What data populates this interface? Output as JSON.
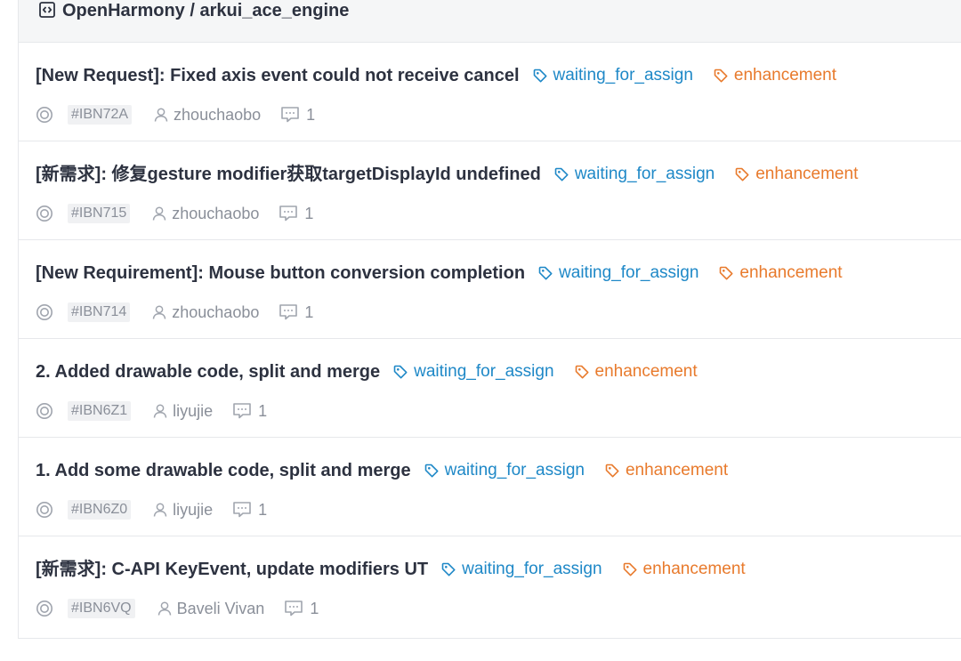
{
  "repo": {
    "title": "OpenHarmony / arkui_ace_engine",
    "icon": "repo-code-icon"
  },
  "colors": {
    "waiting_label": "#1e88c7",
    "enhancement_label": "#e87a2c",
    "meta_text": "#8a8f99"
  },
  "issues": [
    {
      "title": "[New Request]: Fixed axis event could not receive cancel",
      "labels": [
        "waiting_for_assign",
        "enhancement"
      ],
      "number": "#IBN72A",
      "author": "zhouchaobo",
      "comments": "1"
    },
    {
      "title": "[新需求]: 修复gesture modifier获取targetDisplayId undefined",
      "labels": [
        "waiting_for_assign",
        "enhancement"
      ],
      "number": "#IBN715",
      "author": "zhouchaobo",
      "comments": "1"
    },
    {
      "title": "[New Requirement]: Mouse button conversion completion",
      "labels": [
        "waiting_for_assign",
        "enhancement"
      ],
      "number": "#IBN714",
      "author": "zhouchaobo",
      "comments": "1"
    },
    {
      "title": "2. Added drawable code, split and merge",
      "labels": [
        "waiting_for_assign",
        "enhancement"
      ],
      "number": "#IBN6Z1",
      "author": "liyujie",
      "comments": "1"
    },
    {
      "title": "1. Add some drawable code, split and merge",
      "labels": [
        "waiting_for_assign",
        "enhancement"
      ],
      "number": "#IBN6Z0",
      "author": "liyujie",
      "comments": "1"
    },
    {
      "title": "[新需求]: C-API KeyEvent, update modifiers UT",
      "labels": [
        "waiting_for_assign",
        "enhancement"
      ],
      "number": "#IBN6VQ",
      "author": "Baveli Vivan",
      "comments": "1"
    }
  ]
}
